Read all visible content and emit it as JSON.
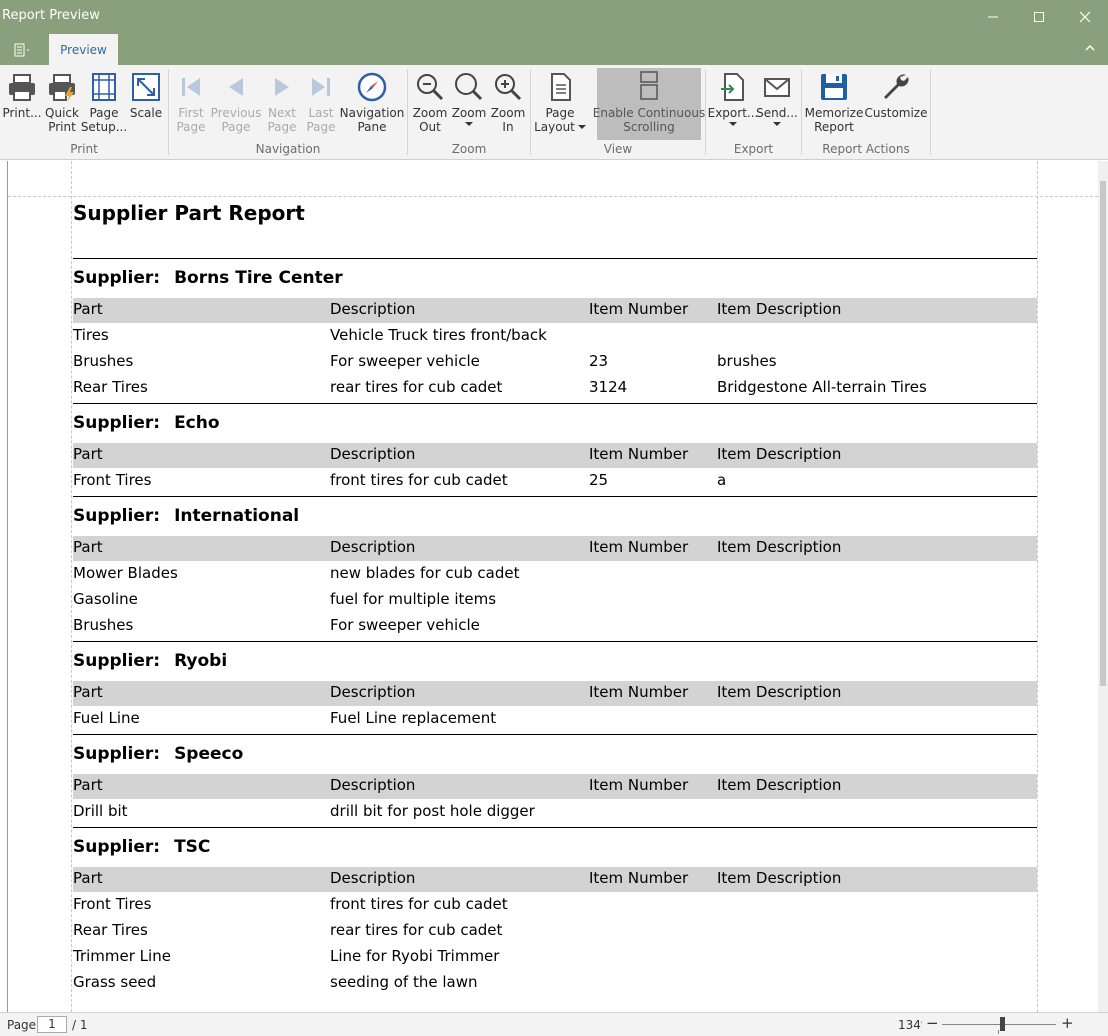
{
  "window": {
    "title": "Report Preview"
  },
  "tabs": [
    {
      "label": "Preview"
    }
  ],
  "ribbon": {
    "groups": {
      "print": "Print",
      "navigation": "Navigation",
      "zoom": "Zoom",
      "view": "View",
      "export": "Export",
      "report_actions": "Report Actions"
    },
    "buttons": {
      "print": "Print...",
      "quick_print": "Quick\nPrint",
      "page_setup": "Page\nSetup...",
      "scale": "Scale",
      "first_page": "First\nPage",
      "previous_page": "Previous\nPage",
      "next_page": "Next\nPage",
      "last_page": "Last\nPage",
      "navigation_pane": "Navigation\nPane",
      "zoom_out": "Zoom\nOut",
      "zoom": "Zoom",
      "zoom_in": "Zoom\nIn",
      "page_layout": "Page\nLayout",
      "enable_continuous_scrolling": "Enable Continuous\nScrolling",
      "export": "Export...",
      "send": "Send...",
      "memorize_report": "Memorize\nReport",
      "customize": "Customize"
    }
  },
  "report": {
    "title": "Supplier Part Report",
    "supplier_label": "Supplier:",
    "columns": [
      "Part",
      "Description",
      "Item Number",
      "Item Description"
    ],
    "sections": [
      {
        "supplier": "Borns Tire Center",
        "rows": [
          [
            "Tires",
            "Vehicle Truck tires front/back",
            "",
            ""
          ],
          [
            "Brushes",
            "For sweeper vehicle",
            "23",
            "brushes"
          ],
          [
            "Rear Tires",
            "rear tires for cub cadet",
            "3124",
            "Bridgestone All-terrain Tires"
          ]
        ]
      },
      {
        "supplier": "Echo",
        "rows": [
          [
            "Front Tires",
            "front tires for cub cadet",
            "25",
            "a"
          ]
        ]
      },
      {
        "supplier": "International",
        "rows": [
          [
            "Mower Blades",
            "new blades for cub cadet",
            "",
            ""
          ],
          [
            "Gasoline",
            "fuel for multiple items",
            "",
            ""
          ],
          [
            "Brushes",
            "For sweeper vehicle",
            "",
            ""
          ]
        ]
      },
      {
        "supplier": "Ryobi",
        "rows": [
          [
            "Fuel Line",
            "Fuel Line replacement",
            "",
            ""
          ]
        ]
      },
      {
        "supplier": "Speeco",
        "rows": [
          [
            "Drill bit",
            "drill bit for post hole digger",
            "",
            ""
          ]
        ]
      },
      {
        "supplier": "TSC",
        "rows": [
          [
            "Front Tires",
            "front tires for cub cadet",
            "",
            ""
          ],
          [
            "Rear Tires",
            "rear tires for cub cadet",
            "",
            ""
          ],
          [
            "Trimmer Line",
            "Line for Ryobi Trimmer",
            "",
            ""
          ],
          [
            "Grass seed",
            "seeding of the lawn",
            "",
            ""
          ]
        ]
      }
    ]
  },
  "statusbar": {
    "page_label": "Page:",
    "current_page": "1",
    "total_pages": "/ 1",
    "zoom_value": "134%",
    "zoom_fraction": 0.53
  },
  "colors": {
    "titlebar": "#8a9f7b",
    "tab_text": "#2d6ca2",
    "header_band": "#d3d3d3"
  }
}
